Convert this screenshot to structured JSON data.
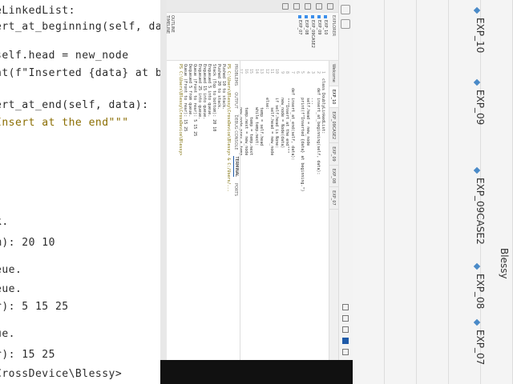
{
  "backdrop_left": {
    "lines": [
      "eLinkedList:",
      "ert_at_beginning(self, data):",
      "self.head = new_node",
      "nt(f\"Inserted {data} at beginning.\")",
      "ert_at_end(self, data):",
      "Insert at the end\"\"\"",
      "k.",
      "m): 20 10",
      "eue.",
      "eue.",
      "r): 5 15 25",
      "ue.",
      "r): 15 25",
      "CrossDevice\\Blessy>"
    ]
  },
  "backdrop_right": {
    "tabs": [
      "EXP_10",
      "EXP_09",
      "EXP_09CASE2",
      "EXP_08",
      "EXP_07"
    ],
    "user": "Blessy"
  },
  "window": {
    "explorer_title": "EXPLORER",
    "files": [
      "EXP_10",
      "EXP_09",
      "EXP_09CASE2",
      "EXP_08",
      "EXP_07"
    ],
    "outline_label": "OUTLINE",
    "timeline_label": "TIMELINE",
    "tabs": [
      "Welcome",
      "EXP_10",
      "EXP_09CASE2",
      "EXP_09",
      "EXP_08",
      "EXP_07"
    ],
    "code": [
      {
        "n": "1",
        "t": "class DoublyLinkedList:"
      },
      {
        "n": "2",
        "t": "    def insert_at_beginning(self, data):"
      },
      {
        "n": "3",
        "t": "        ..."
      },
      {
        "n": "4",
        "t": "        self.head = new_node"
      },
      {
        "n": "5",
        "t": "        print(f\"Inserted {data} at beginning.\")"
      },
      {
        "n": "6",
        "t": ""
      },
      {
        "n": "7",
        "t": "    def insert_at_end(self, data):"
      },
      {
        "n": "8",
        "t": "        \"\"\"Insert at the end\"\"\""
      },
      {
        "n": "9",
        "t": "        new_node = Node(data)"
      },
      {
        "n": "10",
        "t": "        if self.head is None:"
      },
      {
        "n": "11",
        "t": "            self.head = new_node"
      },
      {
        "n": "12",
        "t": "        else:"
      },
      {
        "n": "13",
        "t": "            temp = self.head"
      },
      {
        "n": "14",
        "t": "            while temp.next:"
      },
      {
        "n": "15",
        "t": "                temp = temp.next"
      },
      {
        "n": "16",
        "t": "            temp.next = new_node"
      },
      {
        "n": "17",
        "t": "            new_node.prev = temp"
      }
    ],
    "panel_tabs": [
      "PROBLEMS",
      "OUTPUT",
      "DEBUG CONSOLE",
      "TERMINAL",
      "PORTS"
    ],
    "terminal": [
      "PS C:\\Users\\Blessy\\CrossDevice\\Blessy> & C:/Users/...",
      "Pushed 10 to stack.",
      "Pushed 20 to stack.",
      "Stack (Top to bottom): 20 10",
      "Enqueued 5 into queue.",
      "Enqueued 15 into queue.",
      "Enqueued 25 into queue.",
      "Queue (Front to rear): 5 15 25",
      "Dequeued 5 from queue.",
      "Queue (Front to rear): 15 25",
      "PS C:\\Users\\Blessy\\CrossDevice\\Blessy>"
    ]
  }
}
